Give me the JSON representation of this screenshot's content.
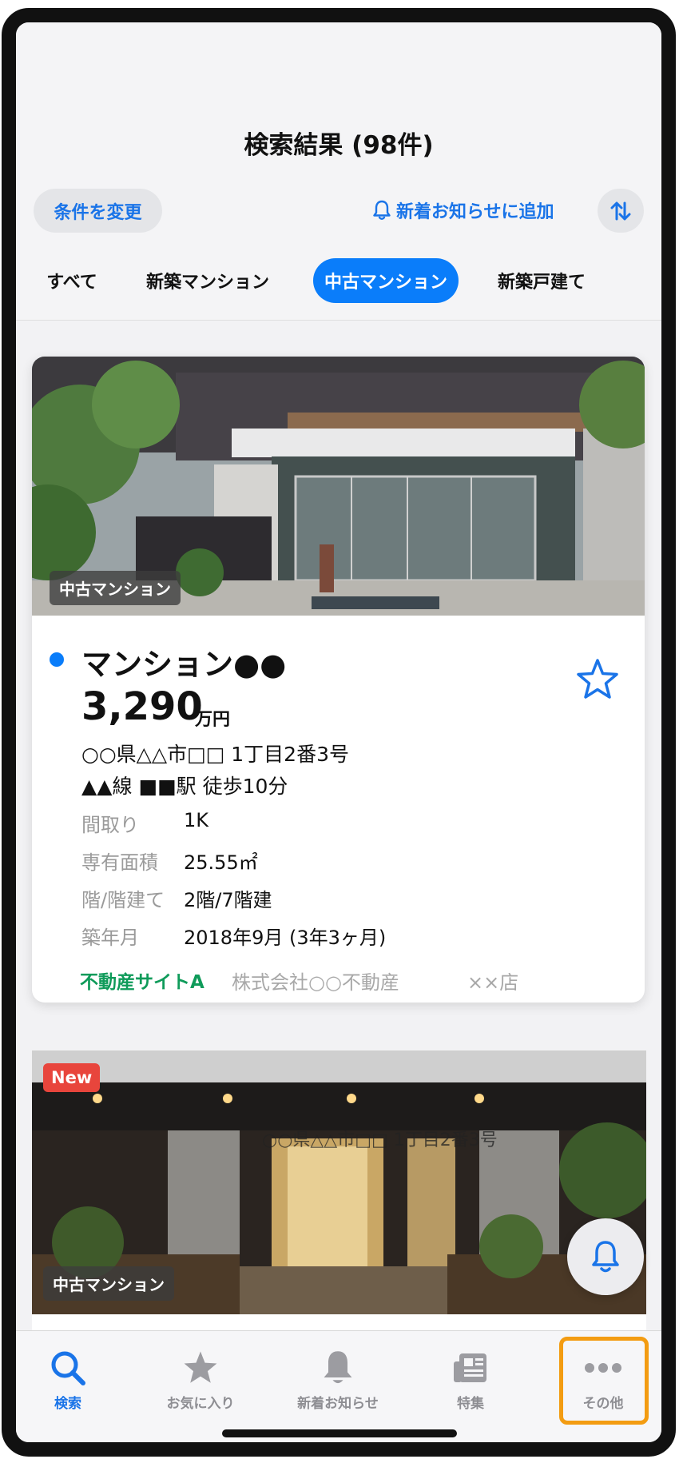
{
  "header": {
    "title": "検索結果 (98件)",
    "change_conditions": "条件を変更",
    "add_notification": "新着お知らせに追加"
  },
  "tabs": [
    {
      "label": "すべて",
      "active": false
    },
    {
      "label": "新築マンション",
      "active": false
    },
    {
      "label": "中古マンション",
      "active": true
    },
    {
      "label": "新築戸建て",
      "active": false
    }
  ],
  "listings": [
    {
      "category": "中古マンション",
      "name": "マンション●●",
      "price": "3,290",
      "price_unit": "万円",
      "address": "○○県△△市□□ 1丁目2番3号",
      "access": "▲▲線 ■■駅 徒歩10分",
      "specs": [
        {
          "label": "間取り",
          "value": "1K"
        },
        {
          "label": "専有面積",
          "value": "25.55㎡"
        },
        {
          "label": "階/階建て",
          "value": "2階/7階建"
        },
        {
          "label": "築年月",
          "value": "2018年9月 (3年3ヶ月)"
        }
      ],
      "source_site": "不動産サイトA",
      "agency": "株式会社○○不動産",
      "branch": "××店"
    },
    {
      "new_badge": "New",
      "category": "中古マンション",
      "photo_overlay_text": "○○県△△市□□ 1丁目2番3号"
    }
  ],
  "tabbar": [
    {
      "label": "検索",
      "icon": "search-icon",
      "active": true
    },
    {
      "label": "お気に入り",
      "icon": "star-icon",
      "active": false
    },
    {
      "label": "新着お知らせ",
      "icon": "bell-icon",
      "active": false
    },
    {
      "label": "特集",
      "icon": "newspaper-icon",
      "active": false
    },
    {
      "label": "その他",
      "icon": "more-icon",
      "active": false
    }
  ],
  "colors": {
    "accent": "#0a7dfa",
    "source_green": "#0f9b5a",
    "new_badge": "#e8453c",
    "highlight": "#f39c12"
  }
}
